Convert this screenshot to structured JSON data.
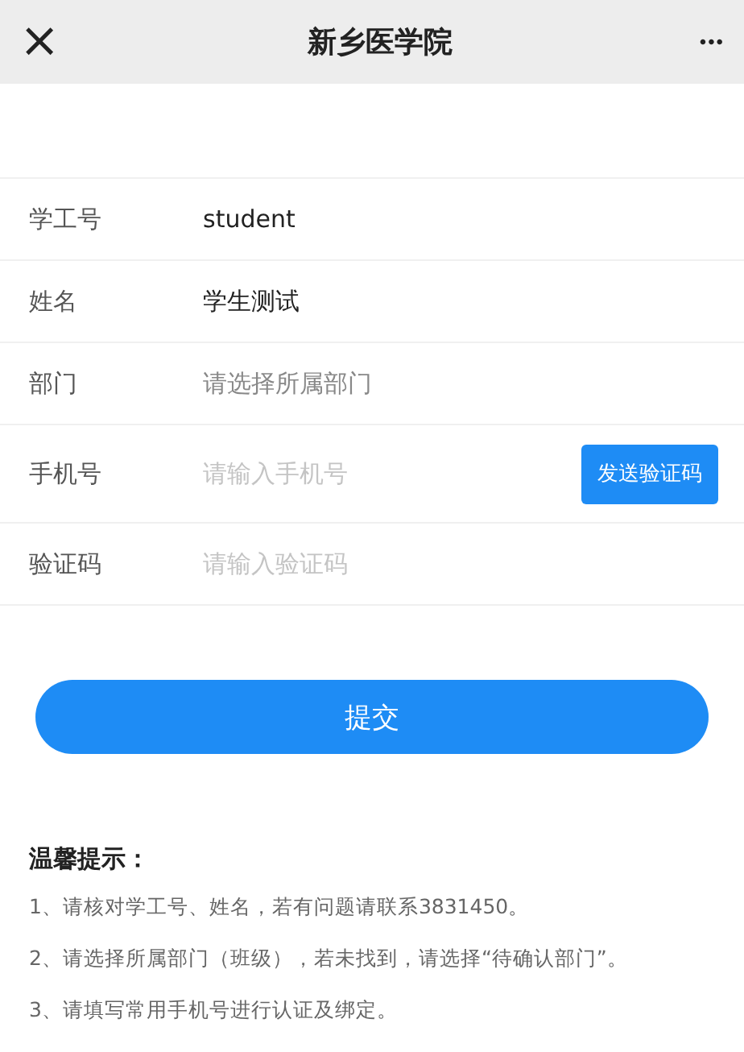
{
  "nav_bar": {
    "close": "×",
    "title": "新乡医学院",
    "more": "•••"
  },
  "form": [
    {
      "label": "学工号",
      "kind": "value",
      "value": "student"
    },
    {
      "label": "姓名",
      "kind": "value",
      "value": "学生测试"
    },
    {
      "label": "部门",
      "kind": "select",
      "placeholder": "请选择所属部门"
    },
    {
      "label": "手机号",
      "kind": "input",
      "placeholder": "请输入手机号",
      "button": "发送验证码"
    },
    {
      "label": "验证码",
      "kind": "input",
      "placeholder": "请输入验证码"
    }
  ],
  "submit_button": "提交",
  "tips": {
    "title": "温馨提示：",
    "items": [
      "1、请核对学工号、姓名，若有问题请联系3831450。",
      "2、请选择所属部门（班级），若未找到，请选择“待确认部门”。",
      "3、请填写常用手机号进行认证及绑定。"
    ]
  }
}
